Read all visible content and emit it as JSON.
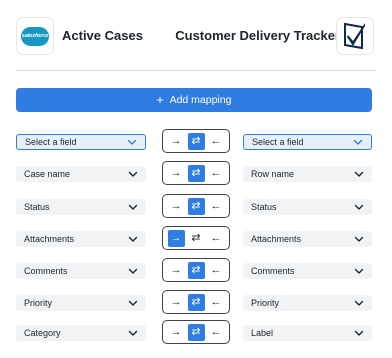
{
  "header": {
    "left_app": {
      "logo_text": "salesforce",
      "title": "Active Cases"
    },
    "right_app": {
      "title": "Customer Delivery Tracker"
    }
  },
  "add_mapping": {
    "icon": "+",
    "label": "Add mapping"
  },
  "direction_icons": {
    "right": "→",
    "both": "⇄",
    "left": "←"
  },
  "mappings": [
    {
      "left": "Select a field",
      "right": "Select a field",
      "direction": "both",
      "placeholder": true
    },
    {
      "left": "Case name",
      "right": "Row name",
      "direction": "both"
    },
    {
      "left": "Status",
      "right": "Status",
      "direction": "both"
    },
    {
      "left": "Attachments",
      "right": "Attachments",
      "direction": "right"
    },
    {
      "left": "Comments",
      "right": "Comments",
      "direction": "both"
    },
    {
      "left": "Priority",
      "right": "Priority",
      "direction": "both"
    },
    {
      "left": "Category",
      "right": "Label",
      "direction": "both"
    }
  ],
  "colors": {
    "accent": "#2f7de1",
    "field_bg": "#f1f3f5",
    "salesforce": "#1798c1"
  }
}
